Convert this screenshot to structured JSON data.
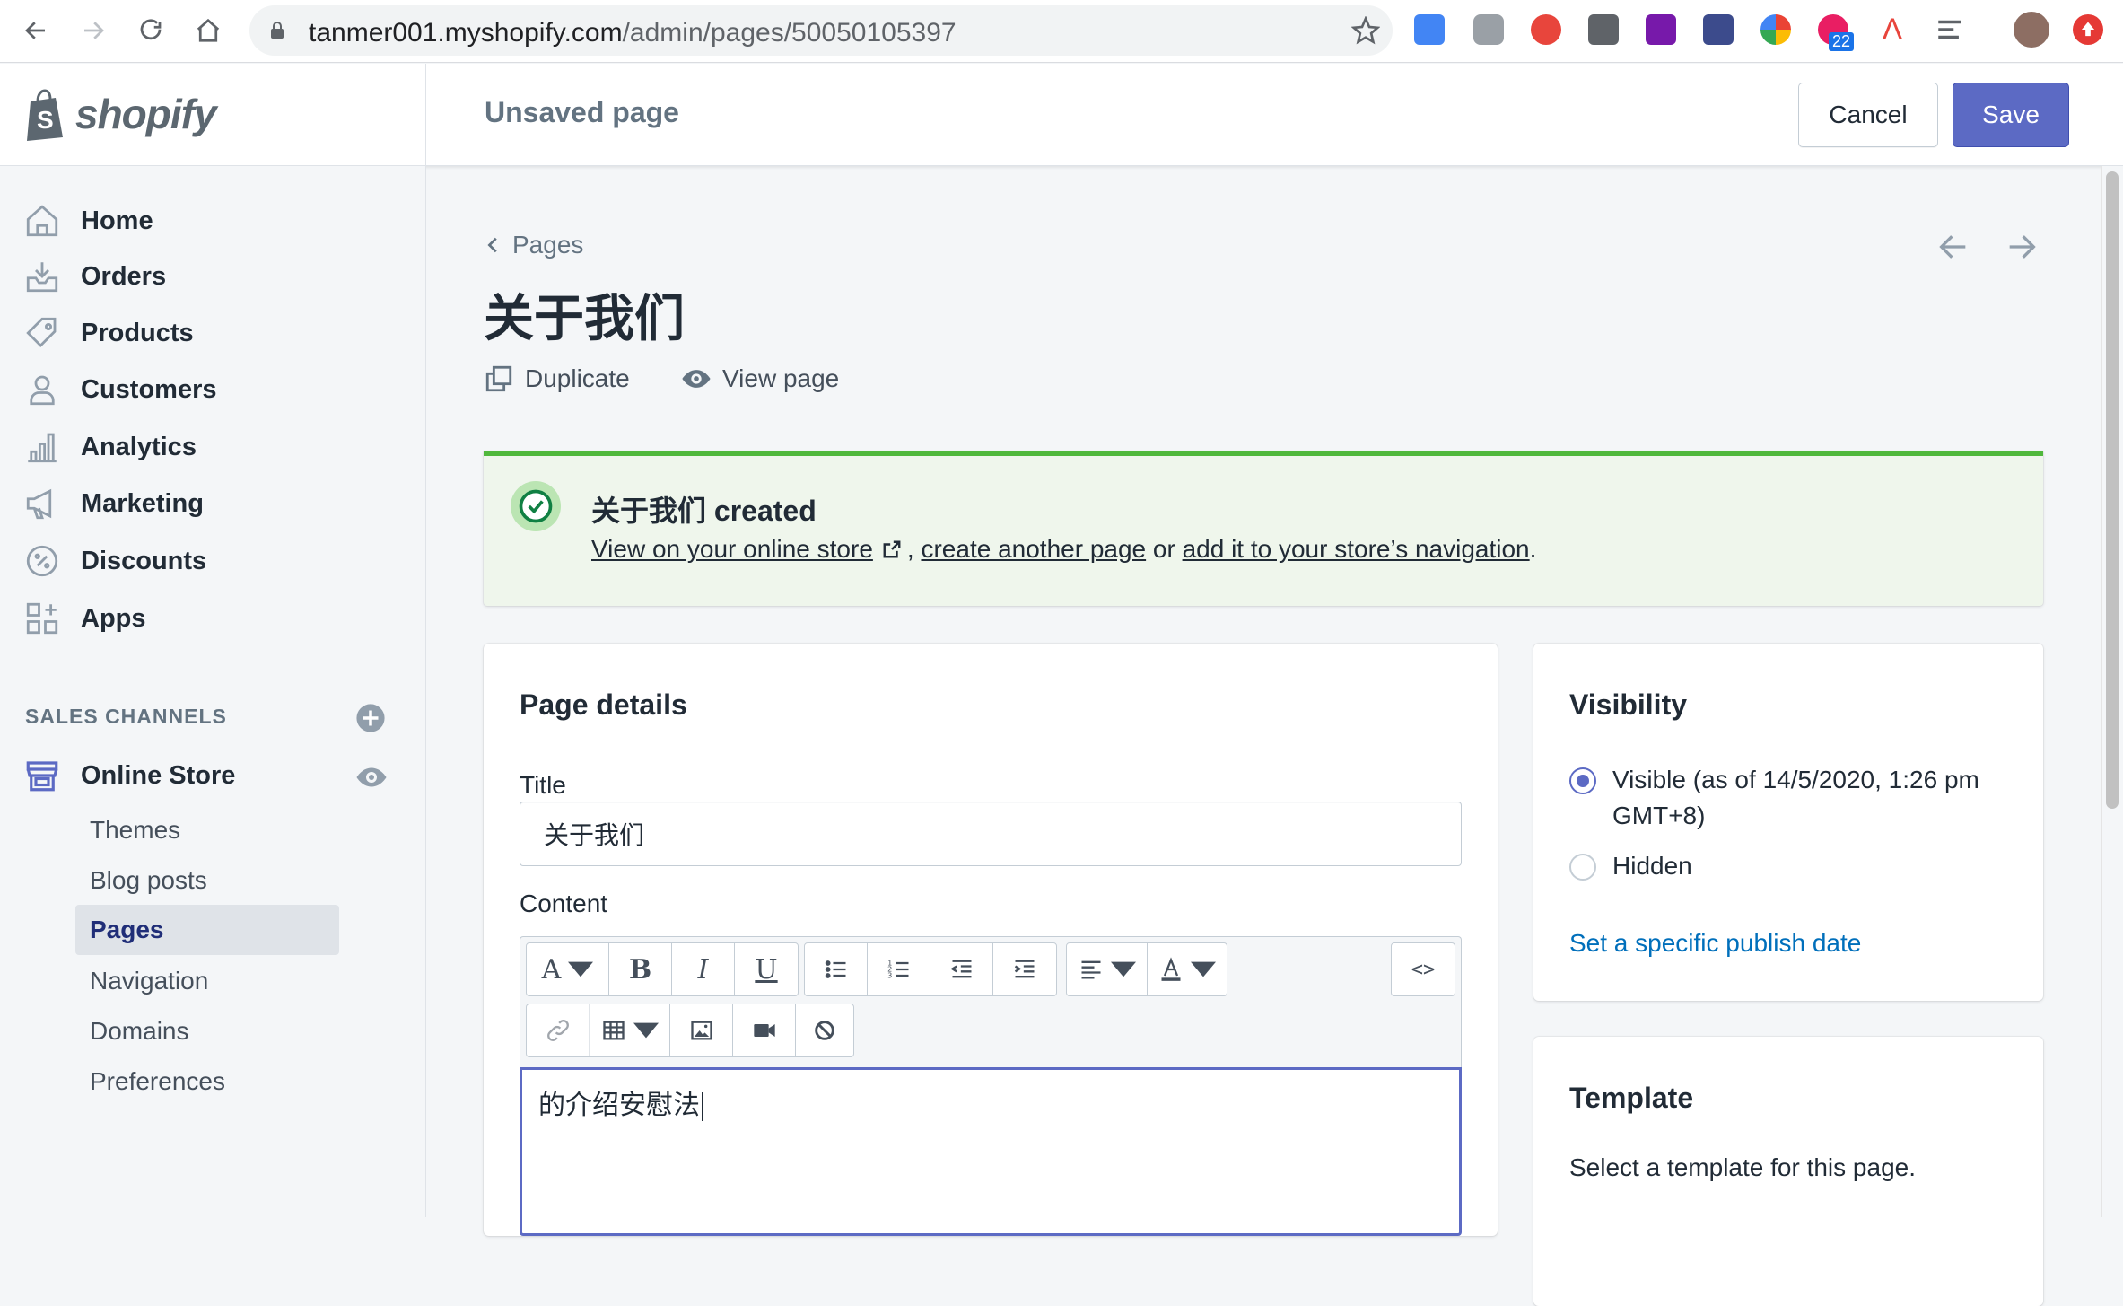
{
  "browser": {
    "url_host": "tanmer001.myshopify.com",
    "url_path": "/admin/pages/50050105397",
    "extension_badge": "22"
  },
  "topbar": {
    "logo_text": "shopify",
    "heading": "Unsaved page",
    "cancel_label": "Cancel",
    "save_label": "Save"
  },
  "sidebar": {
    "items": [
      {
        "label": "Home",
        "icon": "home-icon"
      },
      {
        "label": "Orders",
        "icon": "orders-icon"
      },
      {
        "label": "Products",
        "icon": "tag-icon"
      },
      {
        "label": "Customers",
        "icon": "person-icon"
      },
      {
        "label": "Analytics",
        "icon": "bar-chart-icon"
      },
      {
        "label": "Marketing",
        "icon": "megaphone-icon"
      },
      {
        "label": "Discounts",
        "icon": "discount-icon"
      },
      {
        "label": "Apps",
        "icon": "apps-icon"
      }
    ],
    "sales_channels_heading": "SALES CHANNELS",
    "online_store": "Online Store",
    "sub_items": [
      "Themes",
      "Blog posts",
      "Pages",
      "Navigation",
      "Domains",
      "Preferences"
    ],
    "active_sub_item": "Pages"
  },
  "main": {
    "breadcrumb": "Pages",
    "title": "关于我们",
    "actions": {
      "duplicate": "Duplicate",
      "view_page": "View page"
    },
    "banner": {
      "title": "关于我们 created",
      "link_view": "View on your online store",
      "sep1": ",",
      "link_create": "create another page",
      "or_text": "or",
      "link_nav": "add it to your store’s navigation",
      "end": "."
    },
    "details": {
      "heading": "Page details",
      "title_label": "Title",
      "title_value": "关于我们",
      "content_label": "Content",
      "content_value": "的介绍安慰法",
      "code_btn": "<>"
    },
    "visibility": {
      "heading": "Visibility",
      "options": [
        "Visible (as of 14/5/2020, 1:26 pm GMT+8)",
        "Hidden"
      ],
      "selected": "Visible (as of 14/5/2020, 1:26 pm GMT+8)",
      "publish_link": "Set a specific publish date"
    },
    "template": {
      "heading": "Template",
      "description": "Select a template for this page."
    }
  },
  "colors": {
    "accent": "#5c6ac4",
    "success_bar": "#50b83c",
    "banner_bg": "#eff6ec",
    "link": "#006fbb"
  }
}
